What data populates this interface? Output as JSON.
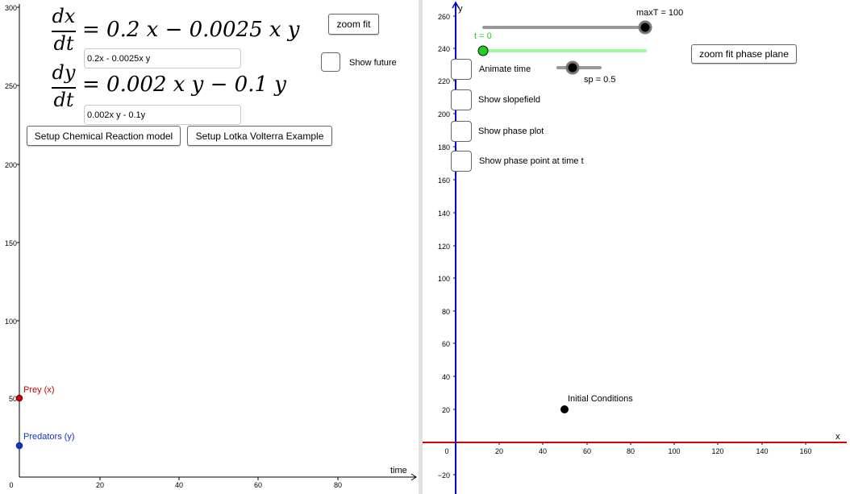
{
  "left": {
    "eq1": {
      "num": "dx",
      "den": "dt",
      "rhs": "= 0.2 x − 0.0025 x y",
      "input": "0.2x - 0.0025x y"
    },
    "eq2": {
      "num": "dy",
      "den": "dt",
      "rhs": "= 0.002 x y − 0.1 y",
      "input": "0.002x y - 0.1y"
    },
    "zoom_fit": "zoom fit",
    "show_future": "Show future",
    "setup_chem": "Setup Chemical Reaction model",
    "setup_lv": "Setup Lotka Volterra Example",
    "axis": {
      "yticks": [
        "300",
        "250",
        "200",
        "150",
        "100",
        "50"
      ],
      "xticks": [
        "0",
        "20",
        "40",
        "60",
        "80"
      ],
      "xlabel": "time"
    },
    "points": {
      "prey": "Prey (x)",
      "pred": "Predators (y)"
    },
    "colors": {
      "prey": "#cc0000",
      "pred": "#1133cc"
    }
  },
  "right": {
    "maxT_label": "maxT = 100",
    "t_label": "t = 0",
    "sp_label": "sp = 0.5",
    "zoom_phase": "zoom fit phase plane",
    "checkboxes": [
      "Animate time",
      "Show slopefield",
      "Show phase plot",
      "Show phase point at time t"
    ],
    "axis": {
      "yticks": [
        "260",
        "240",
        "220",
        "200",
        "180",
        "160",
        "140",
        "120",
        "100",
        "80",
        "60",
        "40",
        "20",
        "−20"
      ],
      "xticks": [
        "0",
        "20",
        "40",
        "60",
        "80",
        "100",
        "120",
        "140",
        "160"
      ],
      "xlabel": "x",
      "ylabel": "y"
    },
    "ic_label": "Initial Conditions",
    "colors": {
      "xaxis": "#dd0000",
      "yaxis": "#0000cc",
      "slider_t": "#99ff99",
      "slider": "#999999"
    }
  }
}
